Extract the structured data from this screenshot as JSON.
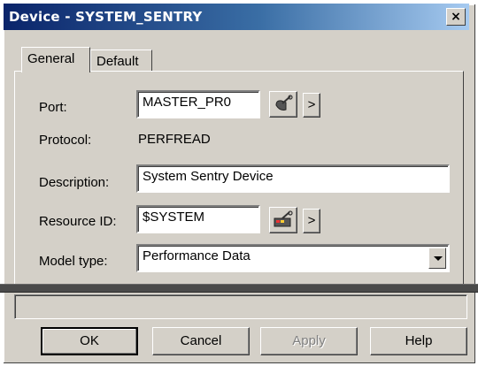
{
  "window": {
    "title": "Device - SYSTEM_SENTRY",
    "close_label": "×"
  },
  "tabs": [
    {
      "label": "General",
      "active": true
    },
    {
      "label": "Default",
      "active": false
    }
  ],
  "form": {
    "port_label": "Port:",
    "port_value": "MASTER_PR0",
    "protocol_label": "Protocol:",
    "protocol_value": "PERFREAD",
    "description_label": "Description:",
    "description_value": "System Sentry Device",
    "resource_label": "Resource ID:",
    "resource_value": "$SYSTEM",
    "model_label": "Model type:",
    "model_value": "Performance Data",
    "more_label": ">"
  },
  "icons": {
    "port_button_icon": "wrench-device-icon",
    "resource_button_icon": "system-device-icon"
  },
  "buttons": {
    "ok": "OK",
    "cancel": "Cancel",
    "apply": "Apply",
    "help": "Help"
  },
  "colors": {
    "titlebar_start": "#0a246a",
    "titlebar_end": "#a6caf0",
    "face": "#d4d0c8"
  }
}
